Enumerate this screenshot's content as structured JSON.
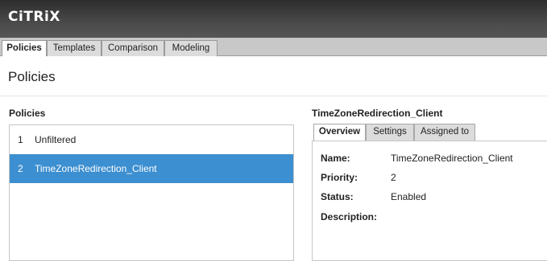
{
  "brand": {
    "logo_text": "CiTRiX"
  },
  "tabs": [
    {
      "label": "Policies",
      "active": true
    },
    {
      "label": "Templates",
      "active": false
    },
    {
      "label": "Comparison",
      "active": false
    },
    {
      "label": "Modeling",
      "active": false
    }
  ],
  "page": {
    "title": "Policies"
  },
  "policies_section": {
    "label": "Policies",
    "items": [
      {
        "priority": "1",
        "name": "Unfiltered",
        "selected": false
      },
      {
        "priority": "2",
        "name": "TimeZoneRedirection_Client",
        "selected": true
      }
    ]
  },
  "details": {
    "title": "TimeZoneRedirection_Client",
    "tabs": [
      {
        "label": "Overview",
        "active": true
      },
      {
        "label": "Settings",
        "active": false
      },
      {
        "label": "Assigned to",
        "active": false
      }
    ],
    "overview": {
      "name_label": "Name:",
      "name_value": "TimeZoneRedirection_Client",
      "priority_label": "Priority:",
      "priority_value": "2",
      "status_label": "Status:",
      "status_value": "Enabled",
      "description_label": "Description:",
      "description_value": ""
    }
  },
  "colors": {
    "selected_row": "#3c8fd0",
    "banner": "#3a3a3a"
  }
}
